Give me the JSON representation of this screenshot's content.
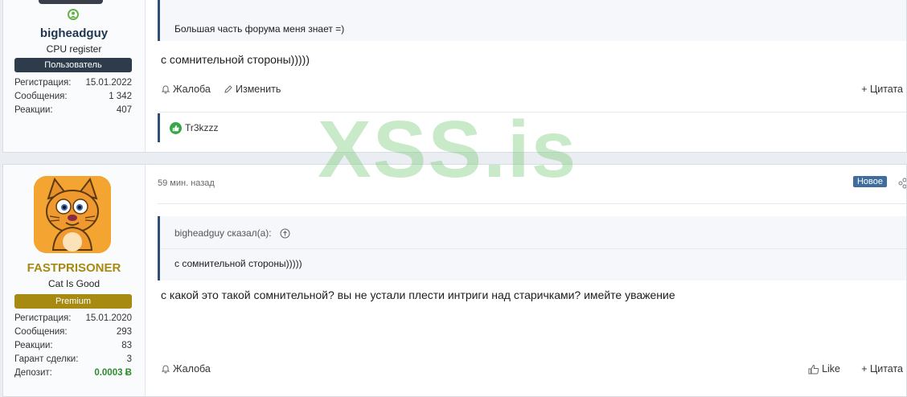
{
  "watermark": "XSS.is",
  "post1": {
    "user": {
      "name": "bigheadguy",
      "title": "CPU register",
      "banner": "Пользователь",
      "banner_color": "#2d3b4a",
      "name_color": "#1f3550"
    },
    "stats": [
      {
        "label": "Регистрация:",
        "value": "15.01.2022"
      },
      {
        "label": "Сообщения:",
        "value": "1 342"
      },
      {
        "label": "Реакции:",
        "value": "407"
      }
    ],
    "quote_text": "Большая часть форума меня знает =)",
    "message": "с сомнительной стороны)))))",
    "actions": {
      "report": "Жалоба",
      "edit": "Изменить",
      "quote": "+ Цитата"
    },
    "reaction_user": "Tr3kzzz"
  },
  "post2": {
    "timestamp": "59 мин. назад",
    "new_badge": "Новое",
    "user": {
      "name": "FASTPRISONER",
      "title": "Cat Is Good",
      "banner": "Premium",
      "banner_color": "#a68a12",
      "name_color": "#a68a12"
    },
    "stats": [
      {
        "label": "Регистрация:",
        "value": "15.01.2020"
      },
      {
        "label": "Сообщения:",
        "value": "293"
      },
      {
        "label": "Реакции:",
        "value": "83"
      },
      {
        "label": "Гарант сделки:",
        "value": "3"
      },
      {
        "label": "Депозит:",
        "value": "0.0003 Ƀ"
      }
    ],
    "quote_head": "bigheadguy сказал(а):",
    "quote_text": "с сомнительной стороны)))))",
    "message": "с какой это такой сомнительной? вы не устали плести интриги над старичками? имейте уважение",
    "actions": {
      "report": "Жалоба",
      "like": "Like",
      "quote": "+ Цитата"
    }
  }
}
